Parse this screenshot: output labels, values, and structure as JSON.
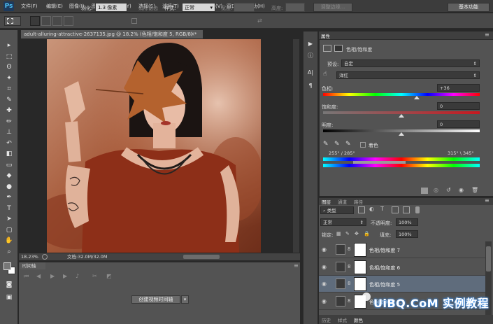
{
  "app": {
    "logo": "Ps"
  },
  "menu": [
    "文件(F)",
    "编辑(E)",
    "图像(I)",
    "图层(L)",
    "文字(Y)",
    "选择(S)",
    "滤镜(T)",
    "3D(D)",
    "视图(V)",
    "窗口(W)",
    "帮助(H)"
  ],
  "window_controls": [
    "–",
    "□",
    "×"
  ],
  "options": {
    "feather_label": "羽化:",
    "feather_value": "1.3 像素",
    "antialias": "消除锯齿",
    "style_label": "样式:",
    "style_value": "正常",
    "width_label": "宽度:",
    "height_label": "高度:",
    "refine_edge": "调整边缘...",
    "workspace": "基本功能"
  },
  "document": {
    "tab_title": "adult-alluring-attractive-2637135.jpg @ 18.2% (色相/饱和度 5, RGB/8) *",
    "zoom": "18.23%",
    "doc_size": "文档:32.0M/32.0M"
  },
  "timeline": {
    "tab": "时间轴",
    "create_button": "创建视频时间轴"
  },
  "properties": {
    "tab": "属性",
    "title": "色相/饱和度",
    "preset_label": "预设:",
    "preset_value": "自定",
    "channel_value": "洋红",
    "hue_label": "色相:",
    "hue_value": "+36",
    "saturation_label": "饱和度:",
    "saturation_value": "0",
    "lightness_label": "明度:",
    "lightness_value": "0",
    "colorize_label": "着色",
    "range_left": "255° / 285°",
    "range_right": "315° \\ 345°"
  },
  "layers_panel": {
    "tabs": [
      "图层",
      "通道",
      "路径"
    ],
    "filter_label": "类型",
    "blend_mode": "正常",
    "opacity_label": "不透明度:",
    "opacity_value": "100%",
    "lock_label": "锁定:",
    "fill_label": "填充:",
    "fill_value": "100%",
    "rows": [
      {
        "name": "色相/饱和度 7",
        "selected": false
      },
      {
        "name": "色相/饱和度 6",
        "selected": false
      },
      {
        "name": "色相/饱和度 5",
        "selected": true
      },
      {
        "name": "色相/饱和度 ...",
        "selected": false
      }
    ],
    "bottom_tabs": [
      "历史",
      "样式",
      "颜色"
    ]
  },
  "watermark": "UiBQ.CoM 实例教程"
}
